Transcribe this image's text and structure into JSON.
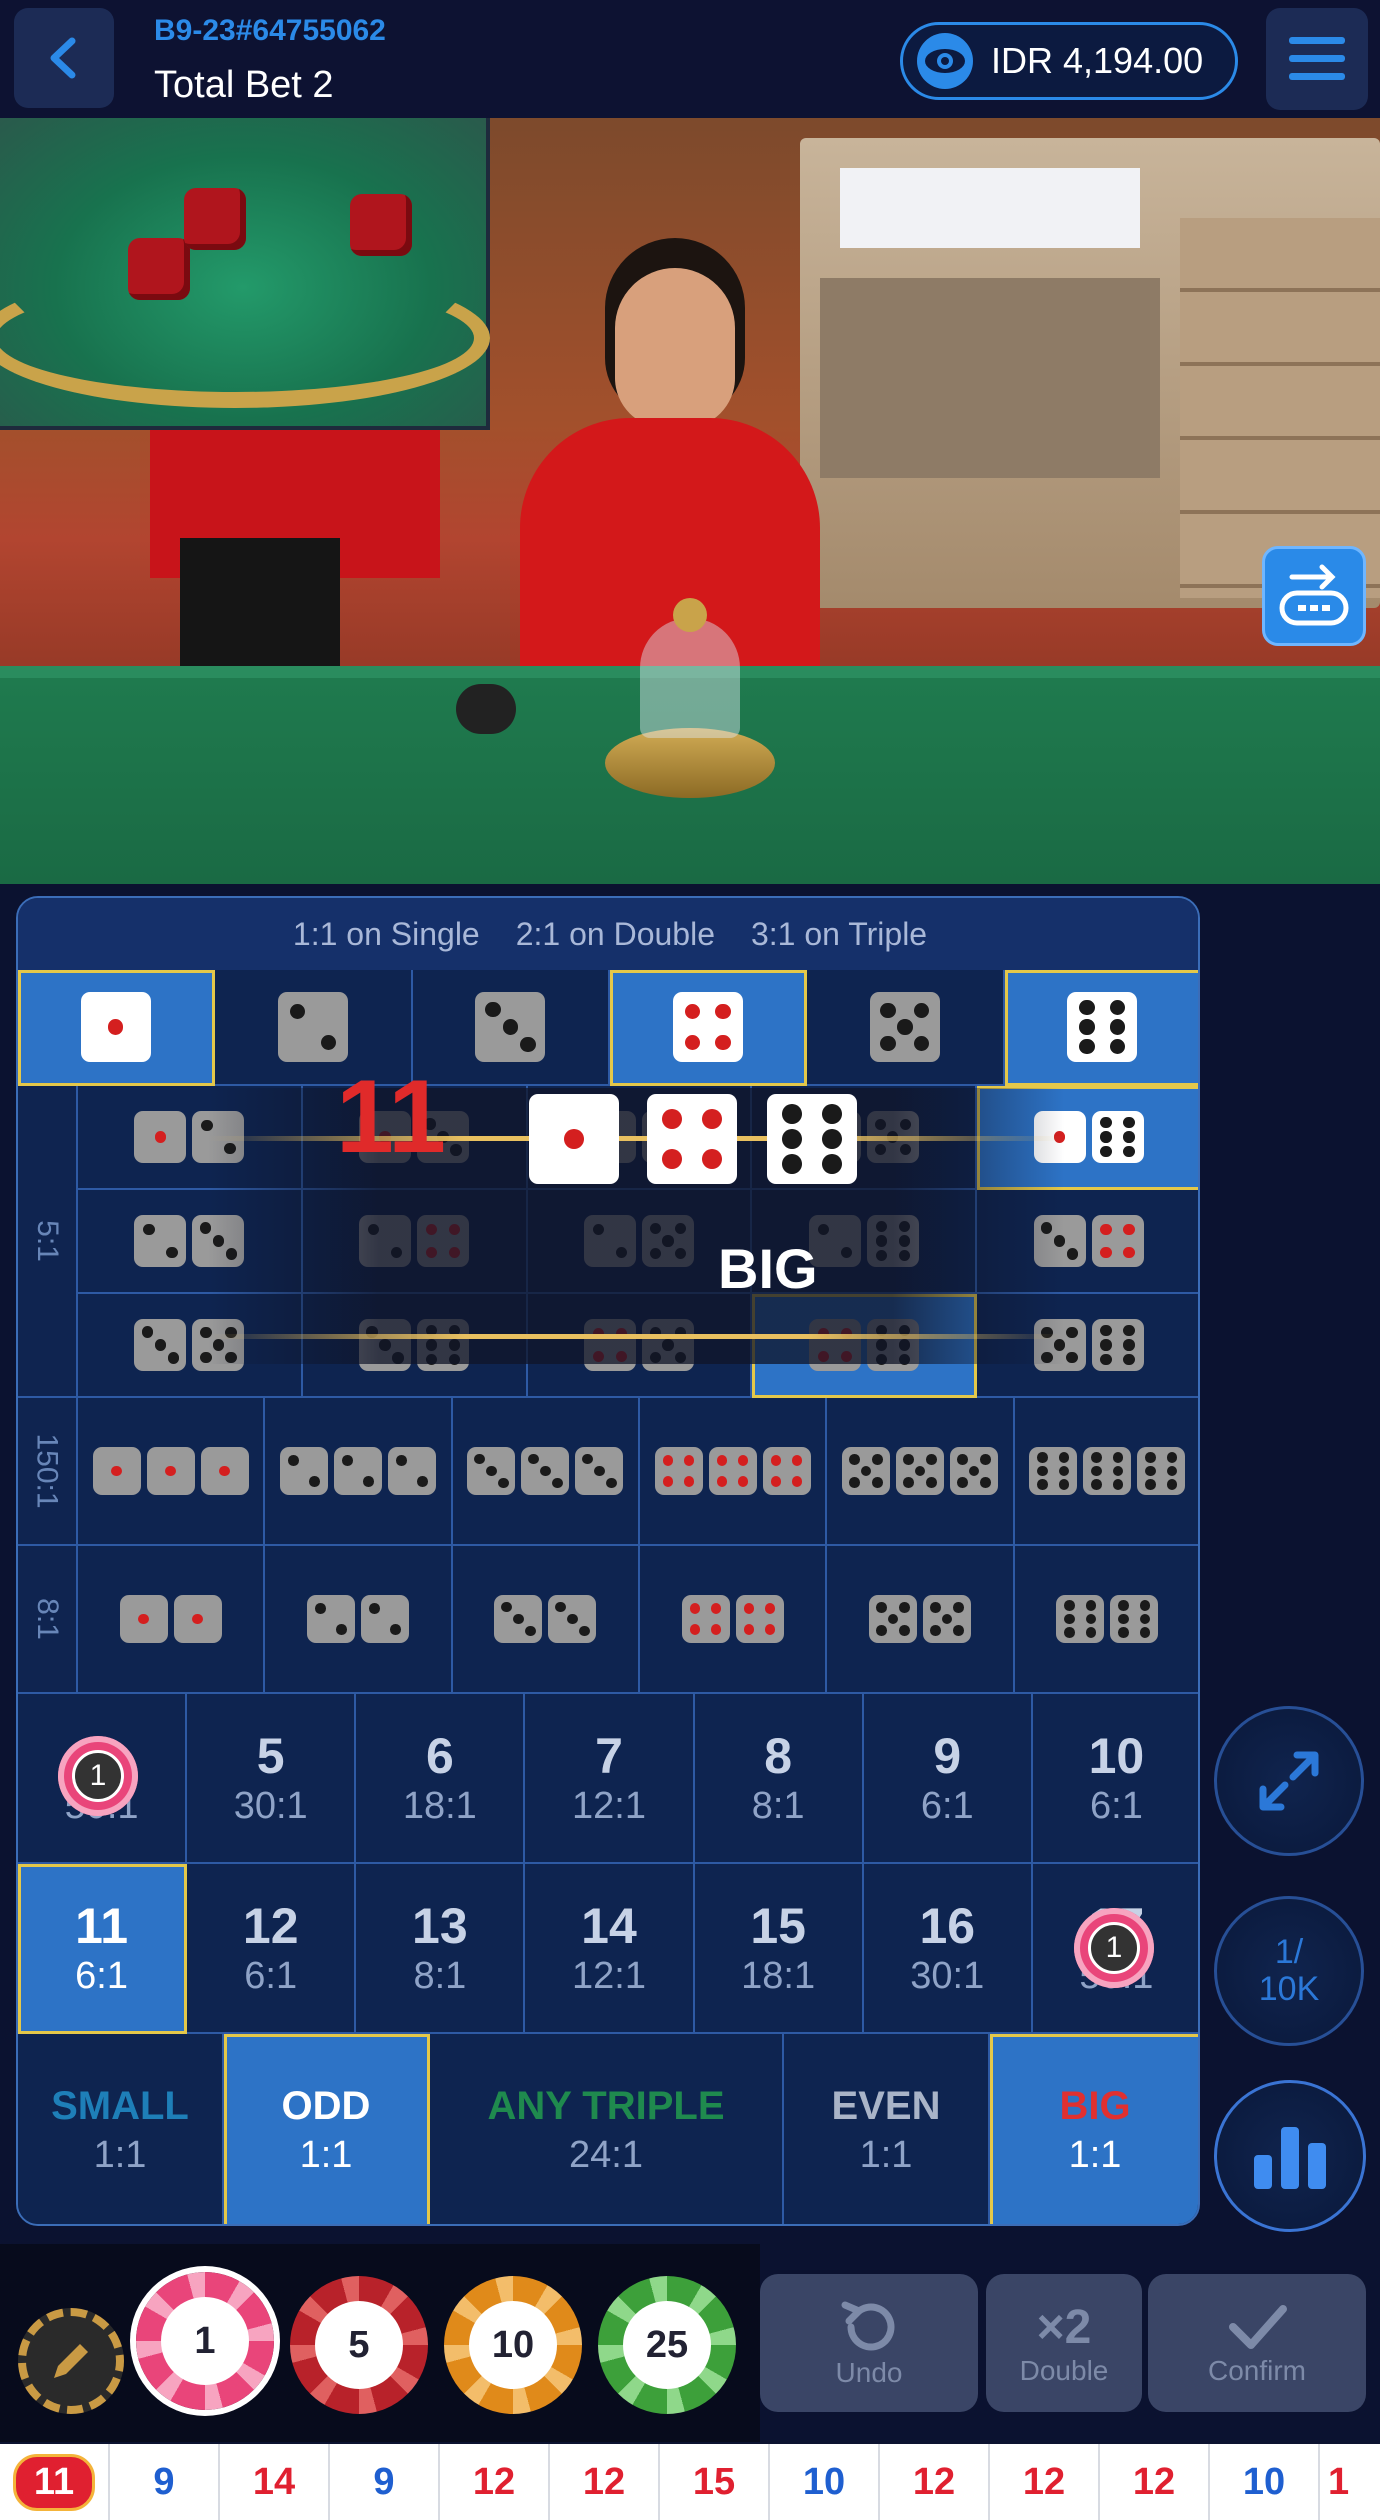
{
  "header": {
    "table_id": "B9-23#64755062",
    "total_bet": "Total Bet 2",
    "balance": "IDR 4,194.00"
  },
  "board": {
    "payout_info": [
      "1:1 on Single",
      "2:1 on Double",
      "3:1 on Triple"
    ],
    "side_labels": [
      "5:1",
      "150:1",
      "8:1"
    ],
    "result": {
      "sum": "11",
      "label": "BIG"
    },
    "sum_row1": [
      {
        "num": "4",
        "odds": "50:1"
      },
      {
        "num": "5",
        "odds": "30:1"
      },
      {
        "num": "6",
        "odds": "18:1"
      },
      {
        "num": "7",
        "odds": "12:1"
      },
      {
        "num": "8",
        "odds": "8:1"
      },
      {
        "num": "9",
        "odds": "6:1"
      },
      {
        "num": "10",
        "odds": "6:1"
      }
    ],
    "sum_row2": [
      {
        "num": "11",
        "odds": "6:1"
      },
      {
        "num": "12",
        "odds": "6:1"
      },
      {
        "num": "13",
        "odds": "8:1"
      },
      {
        "num": "14",
        "odds": "12:1"
      },
      {
        "num": "15",
        "odds": "18:1"
      },
      {
        "num": "16",
        "odds": "30:1"
      },
      {
        "num": "17",
        "odds": "50:1"
      }
    ],
    "bottom": [
      {
        "label": "SMALL",
        "odds": "1:1",
        "color": "#1e7fb8"
      },
      {
        "label": "ODD",
        "odds": "1:1",
        "color": "#ffffff"
      },
      {
        "label": "ANY TRIPLE",
        "odds": "24:1",
        "color": "#1f8a4e"
      },
      {
        "label": "EVEN",
        "odds": "1:1",
        "color": "#a9b4c8"
      },
      {
        "label": "BIG",
        "odds": "1:1",
        "color": "#e03030"
      }
    ],
    "placed_chip": "1"
  },
  "right_controls": {
    "limit": "1/\n10K"
  },
  "chips": [
    "1",
    "5",
    "10",
    "25"
  ],
  "actions": {
    "undo": "Undo",
    "double": "Double",
    "confirm": "Confirm",
    "double_icon": "×2"
  },
  "history": [
    "11",
    "9",
    "14",
    "9",
    "12",
    "12",
    "15",
    "10",
    "12",
    "12",
    "12",
    "10",
    "1"
  ],
  "colors": {
    "accent": "#2b8ae8",
    "highlight": "#2d73c6",
    "gold": "#e4c84a"
  }
}
